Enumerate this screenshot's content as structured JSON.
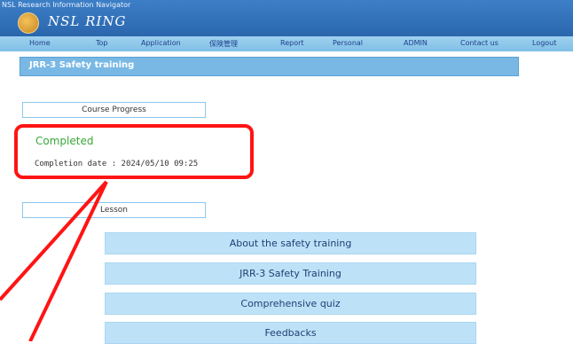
{
  "app": {
    "top_title": "NSL Research Information Navigator",
    "logo_text": "NSL RING"
  },
  "nav": {
    "items": [
      "Home",
      "Top",
      "Application",
      "保険管理",
      "Report",
      "Personal",
      "ADMIN",
      "Contact us",
      "Logout"
    ]
  },
  "page": {
    "section_title": "JRR-3 Safety training",
    "course_progress_label": "Course Progress",
    "status": "Completed",
    "completion_date": "Completion date : 2024/05/10 09:25",
    "lesson_label": "Lesson"
  },
  "lessons": [
    "About the safety training",
    "JRR-3 Safety Training",
    "Comprehensive quiz",
    "Feedbacks"
  ],
  "colors": {
    "accent": "#79b8e4",
    "status_green": "#3aa83a",
    "highlight_red": "#ff1414"
  }
}
